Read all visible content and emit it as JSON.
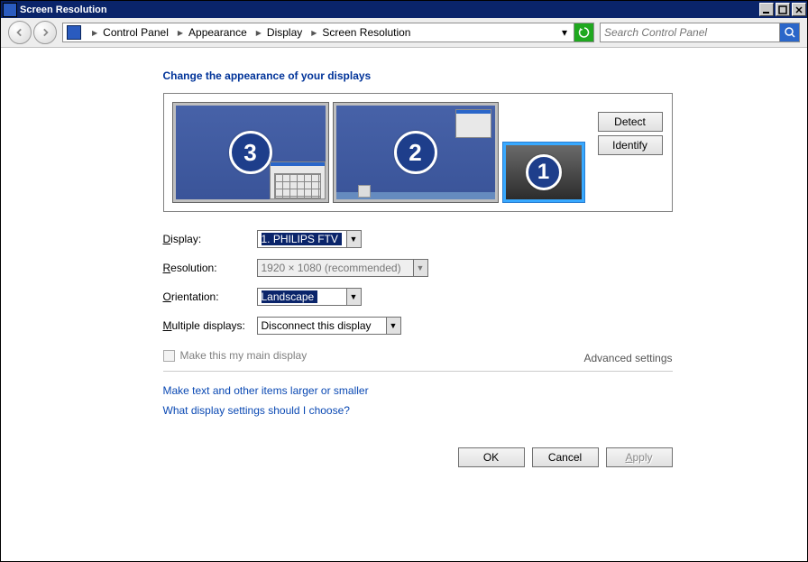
{
  "title": "Screen Resolution",
  "breadcrumb": [
    "Control Panel",
    "Appearance",
    "Display",
    "Screen Resolution"
  ],
  "search_placeholder": "Search Control Panel",
  "heading": "Change the appearance of your displays",
  "detect_label": "Detect",
  "identify_label": "Identify",
  "labels": {
    "display": "Display:",
    "resolution": "Resolution:",
    "orientation": "Orientation:",
    "multiple": "Multiple displays:"
  },
  "values": {
    "display": "1. PHILIPS FTV",
    "resolution": "1920 × 1080 (recommended)",
    "orientation": "Landscape",
    "multiple": "Disconnect this display"
  },
  "checkbox_label": "Make this my main display",
  "advanced_label": "Advanced settings",
  "link_text_size": "Make text and other items larger or smaller",
  "link_help": "What display settings should I choose?",
  "buttons": {
    "ok": "OK",
    "cancel": "Cancel",
    "apply": "Apply"
  },
  "monitors": [
    {
      "num": "3"
    },
    {
      "num": "2"
    },
    {
      "num": "1",
      "selected": true
    }
  ],
  "mnemonic": {
    "d": "D",
    "r": "R",
    "o": "O",
    "m": "M",
    "a": "A"
  }
}
